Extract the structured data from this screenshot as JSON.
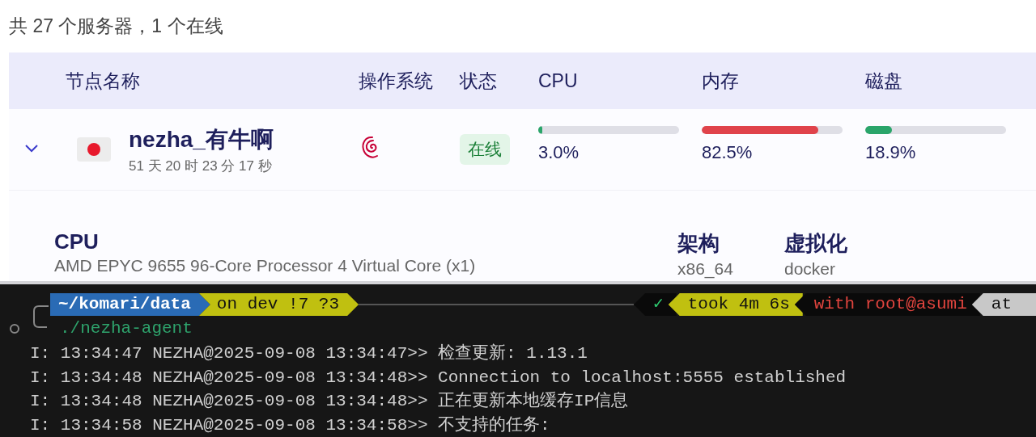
{
  "summary": "共 27 个服务器，1 个在线",
  "table": {
    "columns": [
      "节点名称",
      "操作系统",
      "状态",
      "CPU",
      "内存",
      "磁盘"
    ],
    "rows": [
      {
        "expanded": true,
        "name": "nezha_有牛啊",
        "uptime": "51 天 20 时 23 分 17 秒",
        "status": {
          "label": "在线",
          "kind": "online"
        },
        "metrics": [
          {
            "reading": "3.0%",
            "level": 0.03,
            "color": "#2aa56a"
          },
          {
            "reading": "82.5%",
            "level": 0.825,
            "color": "#e0434b"
          },
          {
            "reading": "18.9%",
            "level": 0.189,
            "color": "#2aa56a"
          }
        ],
        "details": [
          {
            "label": "CPU",
            "value": "AMD EPYC 9655 96-Core Processor 4 Virtual Core (x1)"
          },
          {
            "label": "架构",
            "value": "x86_64"
          },
          {
            "label": "虚拟化",
            "value": "docker"
          }
        ]
      }
    ]
  },
  "terminal": {
    "prompt_left": [
      {
        "text": "~/komari/data",
        "kind": "path"
      },
      {
        "text": "on dev !7 ?3",
        "kind": "git"
      }
    ],
    "prompt_right": [
      {
        "text": "✓",
        "kind": "status"
      },
      {
        "text": "took 4m 6s",
        "kind": "duration"
      },
      {
        "text": "with root@asumi",
        "kind": "user"
      },
      {
        "text": "at",
        "kind": "time"
      }
    ],
    "command": "./nezha-agent",
    "lines": [
      "I: 13:34:47 NEZHA@2025-09-08 13:34:47>> 检查更新: 1.13.1",
      "I: 13:34:48 NEZHA@2025-09-08 13:34:48>> Connection to localhost:5555 established",
      "I: 13:34:48 NEZHA@2025-09-08 13:34:48>> 正在更新本地缓存IP信息",
      "I: 13:34:58 NEZHA@2025-09-08 13:34:58>> 不支持的任务:"
    ]
  }
}
